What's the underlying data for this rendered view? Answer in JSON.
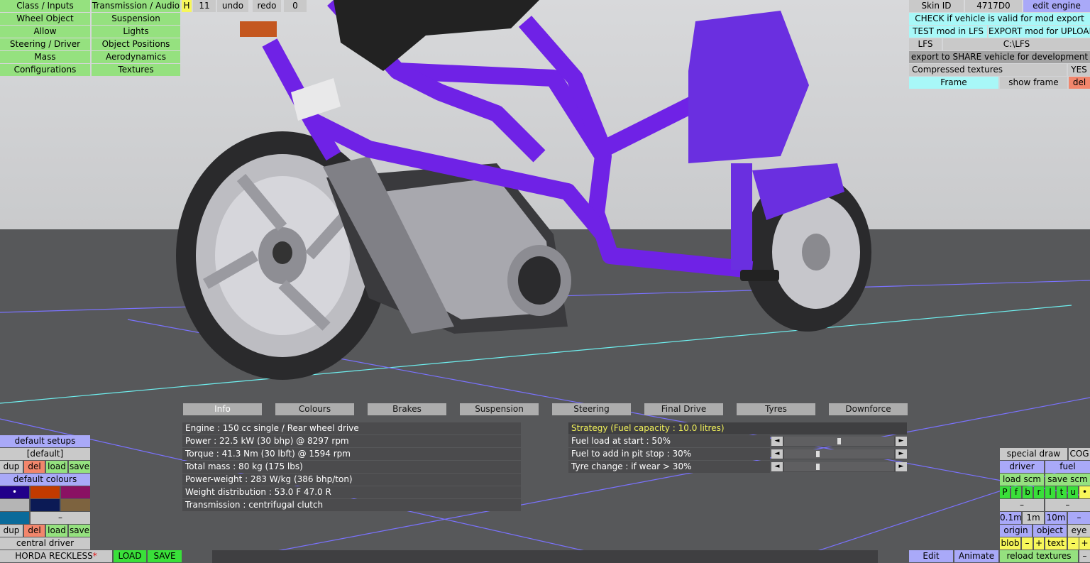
{
  "left_menu": [
    [
      "Class / Inputs",
      "Transmission / Audio"
    ],
    [
      "Wheel Object",
      "Suspension"
    ],
    [
      "Allow",
      "Lights"
    ],
    [
      "Steering / Driver",
      "Object Positions"
    ],
    [
      "Mass",
      "Aerodynamics"
    ],
    [
      "Configurations",
      "Textures"
    ]
  ],
  "top_bar": {
    "h": "H",
    "count": "11",
    "undo": "undo",
    "redo": "redo",
    "redo_count": "0"
  },
  "right_panel": {
    "skin_id_label": "Skin ID",
    "skin_id": "4717D0",
    "edit_engine": "edit engine",
    "check": "CHECK if vehicle is valid for mod export",
    "test": "TEST mod in LFS",
    "export": "EXPORT mod for UPLOAD",
    "lfs": "LFS",
    "lfs_path": "C:\\LFS",
    "share": "export to SHARE vehicle for development",
    "compressed": "Compressed textures",
    "compressed_value": "YES",
    "frame": "Frame",
    "show_frame": "show frame",
    "del": "del"
  },
  "tabs": [
    "Info",
    "Colours",
    "Brakes",
    "Suspension",
    "Steering",
    "Final Drive",
    "Tyres",
    "Downforce"
  ],
  "info": [
    "Engine : 150 cc single / Rear wheel drive",
    "Power : 22.5 kW (30 bhp) @ 8297 rpm",
    "Torque : 41.3 Nm (30 lbft) @ 1594 rpm",
    "Total mass : 80 kg (175 lbs)",
    "Power-weight : 283 W/kg (386 bhp/ton)",
    "Weight distribution : 53.0 F  47.0 R",
    "Transmission : centrifugal clutch"
  ],
  "strategy": {
    "title": "Strategy (Fuel capacity : 10.0 litres)",
    "rows": [
      {
        "label": "Fuel load at start : 50%",
        "level": 0.5
      },
      {
        "label": "Fuel to add in pit stop : 30%",
        "level": 0.3
      },
      {
        "label": "Tyre change : if wear > 30%",
        "level": 0.3
      }
    ]
  },
  "left_bottom": {
    "default_setups": "default setups",
    "default_item": "[default]",
    "dup": "dup",
    "del": "del",
    "load": "load",
    "save": "save",
    "default_colours": "default colours",
    "dash": "–",
    "central_driver": "central driver",
    "car_name": "HORDA RECKLESS",
    "car_star": "*",
    "load_btn": "LOAD",
    "save_btn": "SAVE",
    "swatch_marker": "•",
    "swatch_colors": [
      "#22008a",
      "#c23a00",
      "#8a1163",
      "#b5b5b5",
      "#0b1a55",
      "#7d633f",
      "#0a6a9a"
    ]
  },
  "right_bottom": {
    "special_draw": "special draw",
    "cog": "COG",
    "driver": "driver",
    "fuel": "fuel",
    "load_scm": "load scm",
    "save_scm": "save scm",
    "toggles": [
      "P",
      "f",
      "b",
      "r",
      "l",
      "t",
      "u",
      "•"
    ],
    "dash": "–",
    "dist": [
      "0.1m",
      "1m",
      "10m",
      "–"
    ],
    "origin": "origin",
    "object": "object",
    "eye": "eye",
    "blob": "blob",
    "minus": "–",
    "plus": "+",
    "text": "text",
    "edit": "Edit",
    "animate": "Animate",
    "reload": "reload textures",
    "last_dash": "–"
  }
}
